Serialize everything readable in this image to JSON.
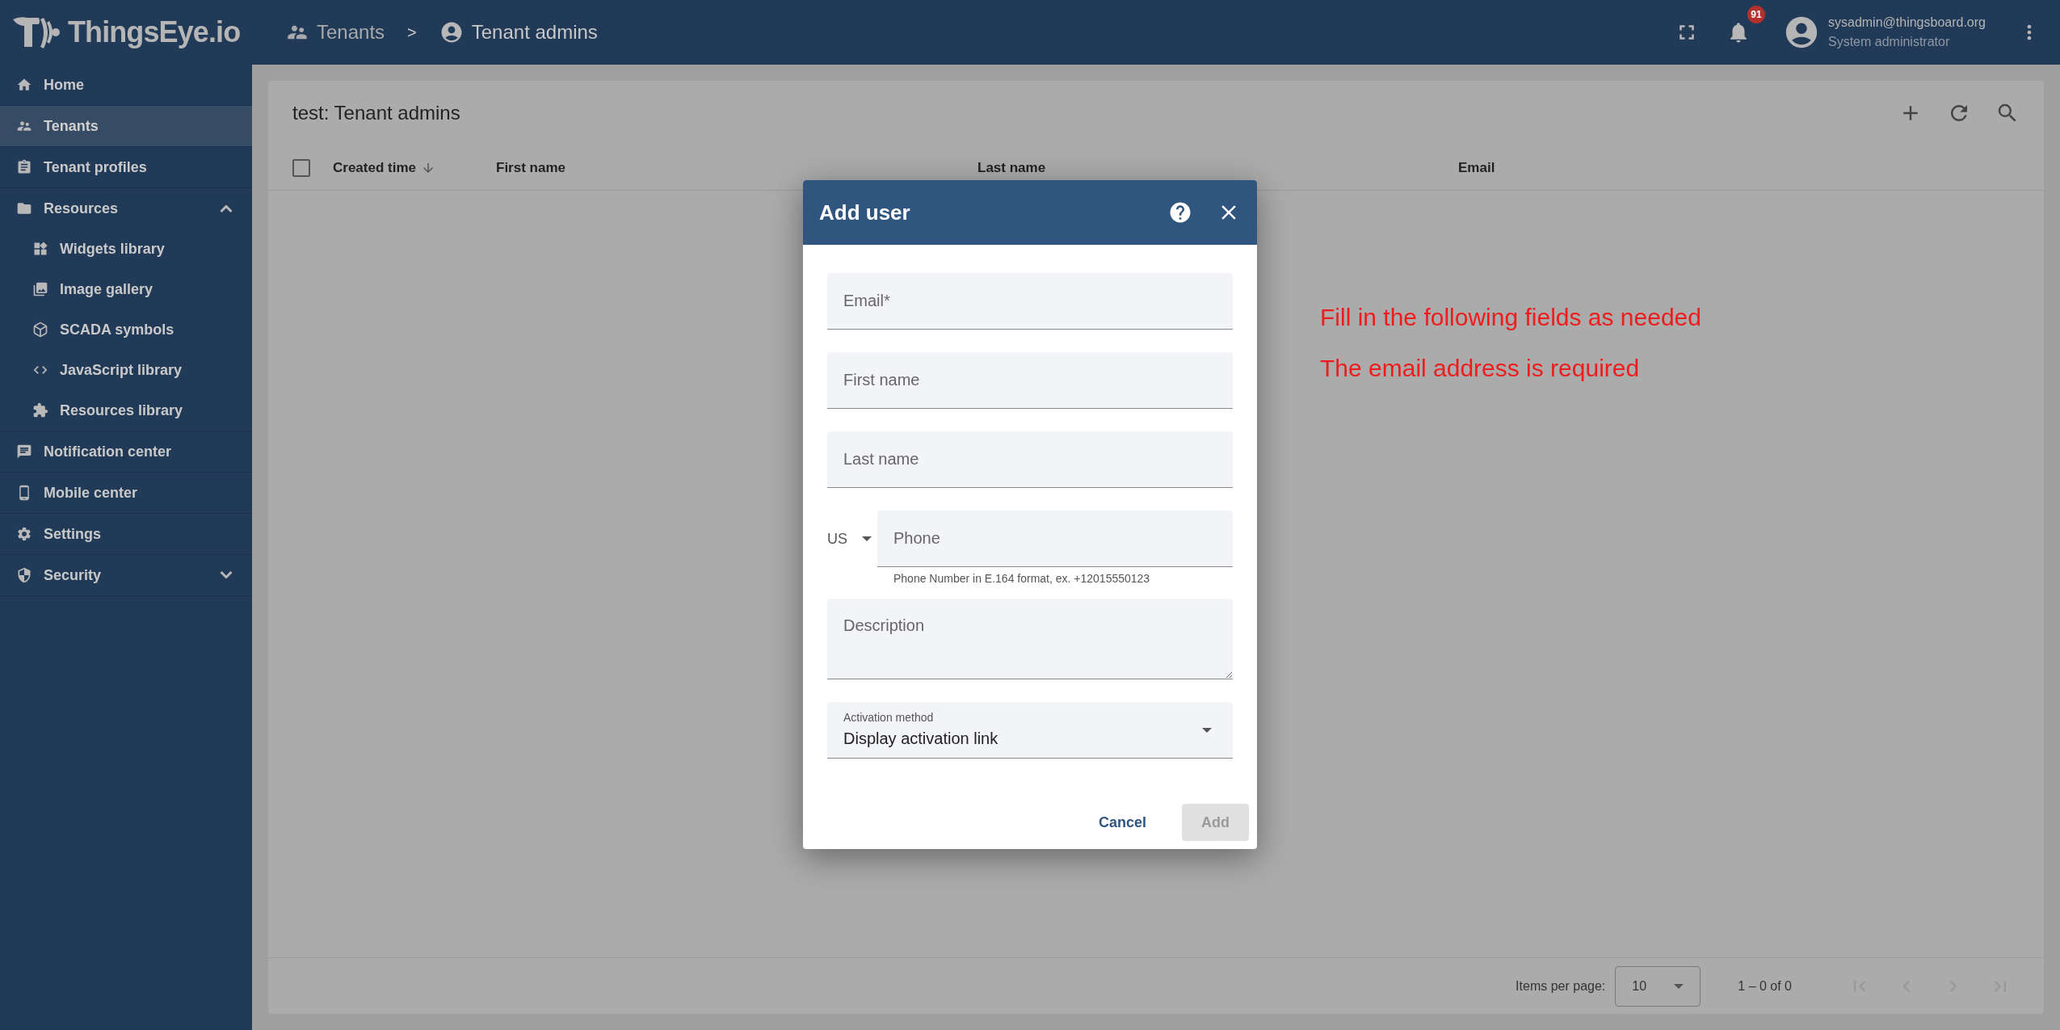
{
  "header": {
    "logo_text": "ThingsEye.io",
    "breadcrumb": [
      {
        "label": "Tenants",
        "kind": "link"
      },
      {
        "label": ">",
        "kind": "separator"
      },
      {
        "label": "Tenant admins",
        "kind": "current"
      }
    ],
    "notifications_badge": "91",
    "user": {
      "email": "sysadmin@thingsboard.org",
      "role": "System administrator"
    }
  },
  "sidebar": {
    "items": [
      {
        "label": "Home",
        "selected": false
      },
      {
        "label": "Tenants",
        "selected": true
      },
      {
        "label": "Tenant profiles",
        "selected": false
      },
      {
        "label": "Resources",
        "selected": false,
        "expanded": true,
        "children": [
          {
            "label": "Widgets library",
            "selected": false
          },
          {
            "label": "Image gallery",
            "selected": false
          },
          {
            "label": "SCADA symbols",
            "selected": false
          },
          {
            "label": "JavaScript library",
            "selected": false
          },
          {
            "label": "Resources library",
            "selected": false
          }
        ]
      },
      {
        "label": "Notification center",
        "selected": false
      },
      {
        "label": "Mobile center",
        "selected": false
      },
      {
        "label": "Settings",
        "selected": false
      },
      {
        "label": "Security",
        "selected": false,
        "expanded": false
      }
    ]
  },
  "table": {
    "title": "test: Tenant admins",
    "select_all_checked": false,
    "columns": [
      {
        "label": "Created time",
        "sorted": true
      },
      {
        "label": "First name",
        "sorted": false
      },
      {
        "label": "Last name",
        "sorted": false
      },
      {
        "label": "Email",
        "sorted": false
      }
    ],
    "pagination": {
      "label": "Items per page:",
      "page_size": "10",
      "range": "1 – 0 of 0"
    }
  },
  "dialog": {
    "title": "Add user",
    "fields": [
      {
        "kind": "text",
        "placeholder": "Email*"
      },
      {
        "kind": "text",
        "placeholder": "First name"
      },
      {
        "kind": "text",
        "placeholder": "Last name"
      },
      {
        "kind": "phone",
        "country": "US",
        "placeholder": "Phone",
        "hint": "Phone Number in E.164 format, ex. +12015550123"
      },
      {
        "kind": "textarea",
        "placeholder": "Description"
      },
      {
        "kind": "select",
        "label": "Activation method",
        "value": "Display activation link"
      }
    ],
    "buttons": [
      {
        "label": "Cancel",
        "disabled": false,
        "kind": "text"
      },
      {
        "label": "Add",
        "disabled": true,
        "kind": "filled"
      }
    ]
  },
  "annotations": [
    "Fill in the following fields as needed",
    "The email address is required"
  ]
}
